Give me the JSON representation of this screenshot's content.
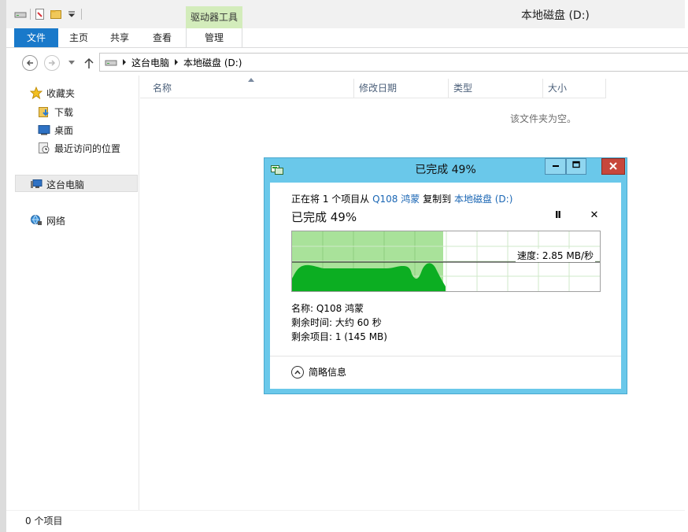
{
  "window": {
    "title": "本地磁盘 (D:)"
  },
  "ribbon": {
    "context_group": "驱动器工具",
    "tabs": [
      {
        "label": "文件"
      },
      {
        "label": "主页"
      },
      {
        "label": "共享"
      },
      {
        "label": "查看"
      },
      {
        "label": "管理"
      }
    ]
  },
  "address": {
    "crumbs": [
      "这台电脑",
      "本地磁盘 (D:)"
    ]
  },
  "nav_pane": {
    "favorites": "收藏夹",
    "downloads": "下载",
    "desktop": "桌面",
    "recent": "最近访问的位置",
    "this_pc": "这台电脑",
    "network": "网络"
  },
  "columns": [
    "名称",
    "修改日期",
    "类型",
    "大小"
  ],
  "content": {
    "empty_message": "该文件夹为空。"
  },
  "status": {
    "items_count": "0 个项目"
  },
  "dialog": {
    "title": "已完成 49%",
    "copy_prefix": "正在将 1 个项目从",
    "source": "Q108 鸿蒙",
    "copy_mid": "复制到",
    "destination": "本地磁盘 (D:)",
    "progress_label": "已完成 49%",
    "progress": 0.49,
    "speed": "速度: 2.85 MB/秒",
    "name_line": "名称: Q108 鸿蒙",
    "time_left": "剩余时间: 大约 60 秒",
    "items_left": "剩余项目: 1 (145 MB)",
    "details_toggle": "简略信息",
    "pause_icon": "Ⅱ",
    "cancel_icon": "✕"
  },
  "colors": {
    "accent": "#1979ca",
    "dialog_frame": "#6ac8ea",
    "graph_fill": "#a9e29a",
    "graph_curve": "#0cae22",
    "close_red": "#c7473b",
    "context_tab": "#d3ecbb"
  }
}
